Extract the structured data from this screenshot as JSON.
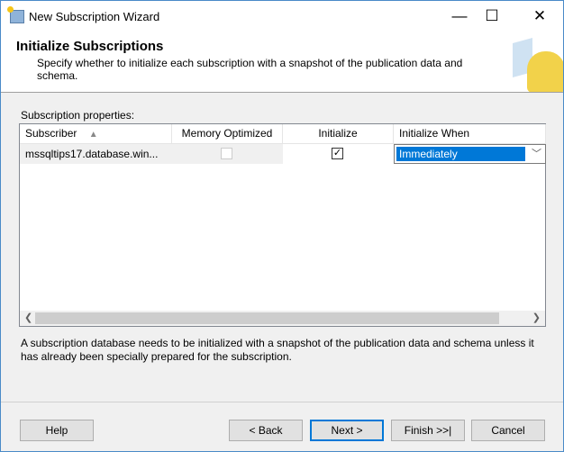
{
  "window": {
    "title": "New Subscription Wizard",
    "minimize": "—",
    "maximize": "☐",
    "close": "✕"
  },
  "header": {
    "title": "Initialize Subscriptions",
    "subtitle": "Specify whether to initialize each subscription with a snapshot of the publication data and schema."
  },
  "grid": {
    "label": "Subscription properties:",
    "columns": [
      "Subscriber",
      "Memory Optimized",
      "Initialize",
      "Initialize When"
    ],
    "sort_indicator": "▲",
    "rows": [
      {
        "subscriber": "mssqltips17.database.win...",
        "memory_optimized": false,
        "initialize": true,
        "initialize_when": "Immediately"
      }
    ]
  },
  "description": "A subscription database needs to be initialized with a snapshot of the publication data and schema unless it has already been specially prepared for the subscription.",
  "buttons": {
    "help": "Help",
    "back": "< Back",
    "next": "Next >",
    "finish": "Finish >>|",
    "cancel": "Cancel"
  }
}
